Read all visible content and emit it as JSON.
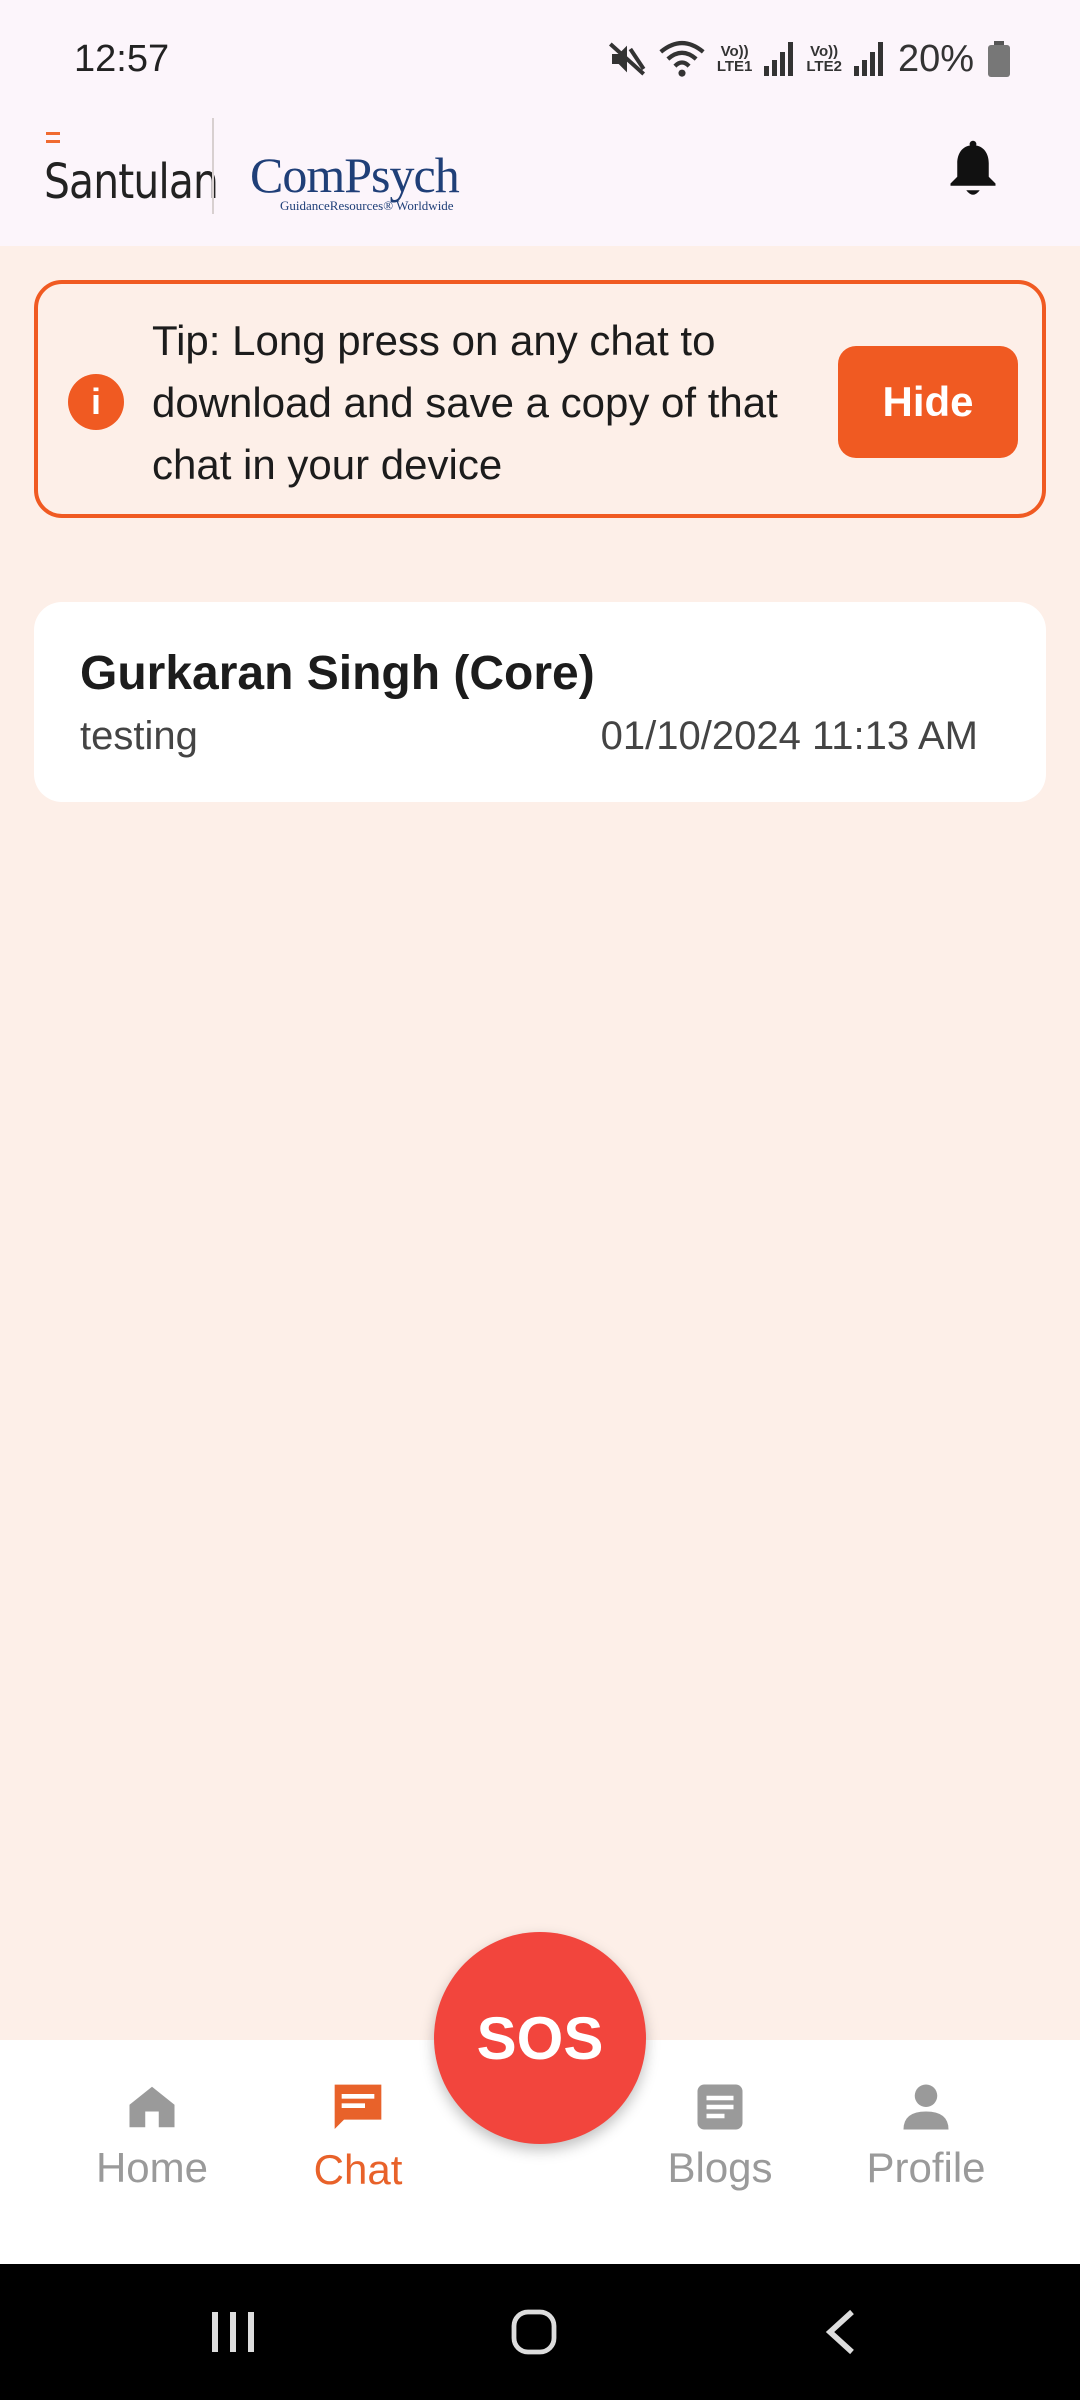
{
  "status_bar": {
    "time": "12:57",
    "lte1": "LTE1",
    "lte2": "LTE2",
    "volte1": "Vo))",
    "volte2": "Vo))",
    "battery": "20%",
    "icons": [
      "mute-icon",
      "wifi-icon",
      "signal-icon",
      "signal-icon",
      "battery-icon"
    ]
  },
  "header": {
    "brand_1": "Santulan",
    "brand_2": "ComPsych",
    "brand_2_sub": "GuidanceResources® Worldwide",
    "notification_icon": "bell-icon"
  },
  "tip": {
    "text": "Tip: Long press on any chat to download and save a copy of that chat in your device",
    "hide_label": "Hide",
    "accent": "#f05a22"
  },
  "chats": [
    {
      "name": "Gurkaran Singh (Core)",
      "preview": "testing",
      "timestamp": "01/10/2024 11:13 AM"
    }
  ],
  "nav": {
    "items": [
      {
        "label": "Home",
        "icon": "home-icon"
      },
      {
        "label": "Chat",
        "icon": "chat-icon",
        "active": true
      },
      {
        "label": "Blogs",
        "icon": "blog-icon"
      },
      {
        "label": "Profile",
        "icon": "profile-icon"
      }
    ],
    "sos_label": "SOS",
    "sos_color": "#f2453d",
    "active_color": "#e8622a"
  }
}
